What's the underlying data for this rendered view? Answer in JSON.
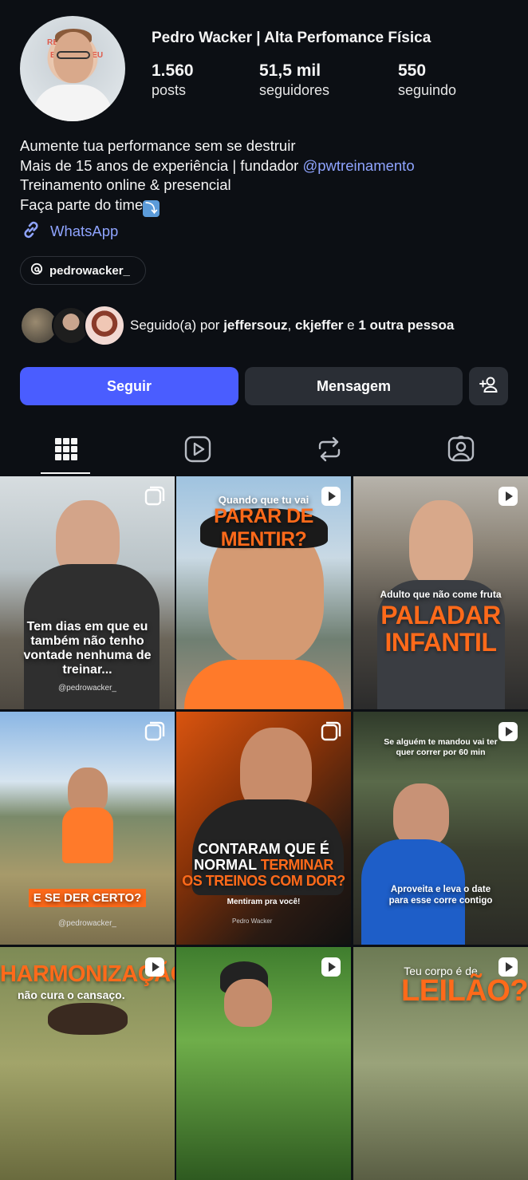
{
  "profile": {
    "name": "Pedro Wacker | Alta Perfomance Física",
    "avatar_sign_1": "RE    NFIE",
    "avatar_sign_2": "E C   TE O SEU",
    "stats": {
      "posts_value": "1.560",
      "posts_label": "posts",
      "followers_value": "51,5 mil",
      "followers_label": "seguidores",
      "following_value": "550",
      "following_label": "seguindo"
    },
    "bio": {
      "line1": "Aumente tua performance sem se destruir",
      "line2_prefix": "Mais de 15 anos de experiência | fundador ",
      "line2_mention": "@pwtreinamento",
      "line3": "Treinamento online & presencial",
      "line4": "Faça parte do time",
      "line4_emoji": "⤵"
    },
    "link_label": "WhatsApp",
    "threads_handle": "pedrowacker_",
    "followed_by": {
      "prefix": "Seguido(a) por ",
      "user1": "jeffersouz",
      "sep": ", ",
      "user2": "ckjeffer",
      "mid": " e ",
      "others": "1 outra pessoa"
    }
  },
  "actions": {
    "follow_label": "Seguir",
    "message_label": "Mensagem",
    "add_user_icon": "person-add-icon"
  },
  "tabs": [
    {
      "name": "posts",
      "icon": "grid-icon",
      "active": true
    },
    {
      "name": "reels",
      "icon": "reels-icon",
      "active": false
    },
    {
      "name": "reposts",
      "icon": "repost-icon",
      "active": false
    },
    {
      "name": "tagged",
      "icon": "tagged-icon",
      "active": false
    }
  ],
  "posts": [
    {
      "caption": "Tem dias em que eu também não tenho vontade nenhuma de treinar...",
      "handle": "@pedrowacker_",
      "badge": "carousel-icon"
    },
    {
      "title_top": "Quando que tu vai",
      "title_main": "PARAR DE MENTIR?",
      "badge": "reel-icon"
    },
    {
      "title_top": "Adulto que não come fruta",
      "title_main": "PALADAR INFANTIL",
      "badge": "reel-icon"
    },
    {
      "caption": "E SE DER CERTO?",
      "handle": "@pedrowacker_",
      "badge": "carousel-icon"
    },
    {
      "title_a": "CONTARAM QUE É",
      "title_b": "NORMAL ",
      "title_b_orange": "TERMINAR",
      "title_c": "OS TREINOS COM DOR?",
      "sub": "Mentiram pra você!",
      "footer_brand": "Pedro Wacker",
      "badge": "carousel-icon"
    },
    {
      "title_top": "Se alguém te mandou vai ter quer correr por 60 min",
      "caption": "Aproveita e leva o date para esse corre contigo",
      "badge": "reel-icon"
    },
    {
      "title_main": "HARMONIZAÇÃO",
      "sub": "não cura o cansaço.",
      "badge": "reel-icon"
    },
    {
      "badge": "reel-icon"
    },
    {
      "title_top": "Teu corpo é de",
      "title_main": "LEILÃO?",
      "badge": "reel-icon"
    }
  ],
  "colors": {
    "background": "#0c0f14",
    "accent_blue": "#4a5dff",
    "link_blue": "#8fa4ff",
    "button_dark": "#2a2e35",
    "caption_orange": "#ff6a1a"
  }
}
